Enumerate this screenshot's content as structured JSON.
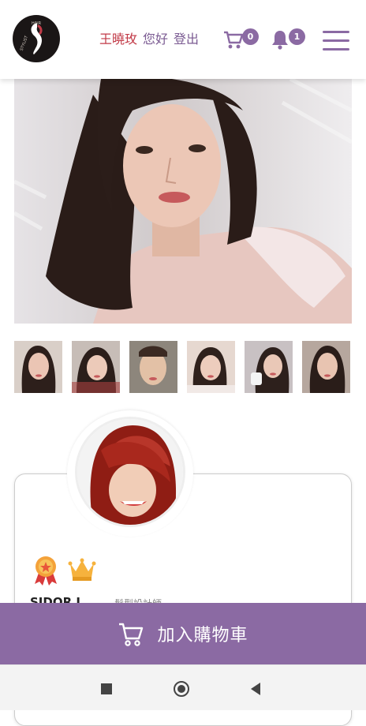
{
  "header": {
    "logo_text": "S",
    "logo_small": "HAIR",
    "logo_side": "STYLIST",
    "user_name": "王曉玫",
    "greeting": "您好",
    "logout_label": "登出",
    "cart_count": "0",
    "notification_count": "1"
  },
  "gallery": {
    "main_photo_alt": "Portrait photo",
    "thumbnail_count": 6
  },
  "profile": {
    "stylist_name": "SIDOR L",
    "stylist_role": "髮型設計師",
    "badges": [
      "medal-icon",
      "crown-icon"
    ]
  },
  "actions": {
    "add_to_cart_label": "加入購物車"
  },
  "colors": {
    "brand_purple": "#8b6aa3",
    "user_name_red": "#c23b48"
  }
}
